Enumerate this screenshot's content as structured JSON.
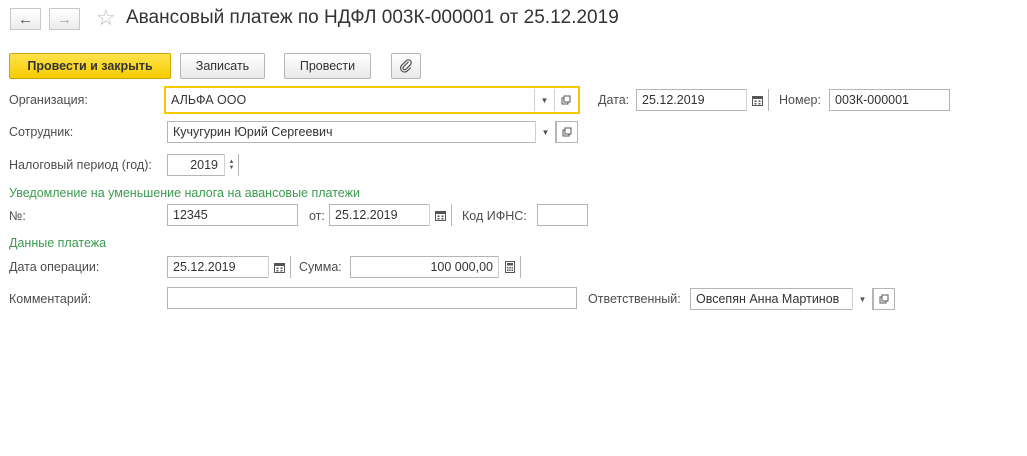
{
  "nav": {
    "back_icon": "arrow-left-icon",
    "forward_icon": "arrow-right-icon",
    "favorite_icon": "star-icon"
  },
  "window": {
    "title": "Авансовый платеж по НДФЛ 003К-000001 от 25.12.2019"
  },
  "toolbar": {
    "post_close_label": "Провести и закрыть",
    "save_label": "Записать",
    "post_label": "Провести",
    "attach_icon": "paperclip-icon"
  },
  "form": {
    "organization": {
      "label": "Организация:",
      "value": "АЛЬФА ООО"
    },
    "date": {
      "label": "Дата:",
      "value": "25.12.2019"
    },
    "number": {
      "label": "Номер:",
      "value": "003К-000001"
    },
    "employee": {
      "label": "Сотрудник:",
      "value": "Кучугурин Юрий Сергеевич"
    },
    "tax_period": {
      "label": "Налоговый период (год):",
      "value": "2019"
    },
    "notice_section": "Уведомление на уменьшение налога на авансовые платежи",
    "notice_number": {
      "label": "№:",
      "value": "12345"
    },
    "notice_date": {
      "label": "от:",
      "value": "25.12.2019"
    },
    "ifns_code": {
      "label": "Код ИФНС:",
      "value": ""
    },
    "payment_section": "Данные платежа",
    "operation_date": {
      "label": "Дата операции:",
      "value": "25.12.2019"
    },
    "amount": {
      "label": "Сумма:",
      "value": "100 000,00"
    },
    "comment": {
      "label": "Комментарий:",
      "value": ""
    },
    "responsible": {
      "label": "Ответственный:",
      "value": "Овсепян Анна Мартинов"
    }
  },
  "colors": {
    "primary_button": "#f5cd00",
    "section_heading": "#3c9a4f",
    "focus_border": "#f5c800"
  }
}
